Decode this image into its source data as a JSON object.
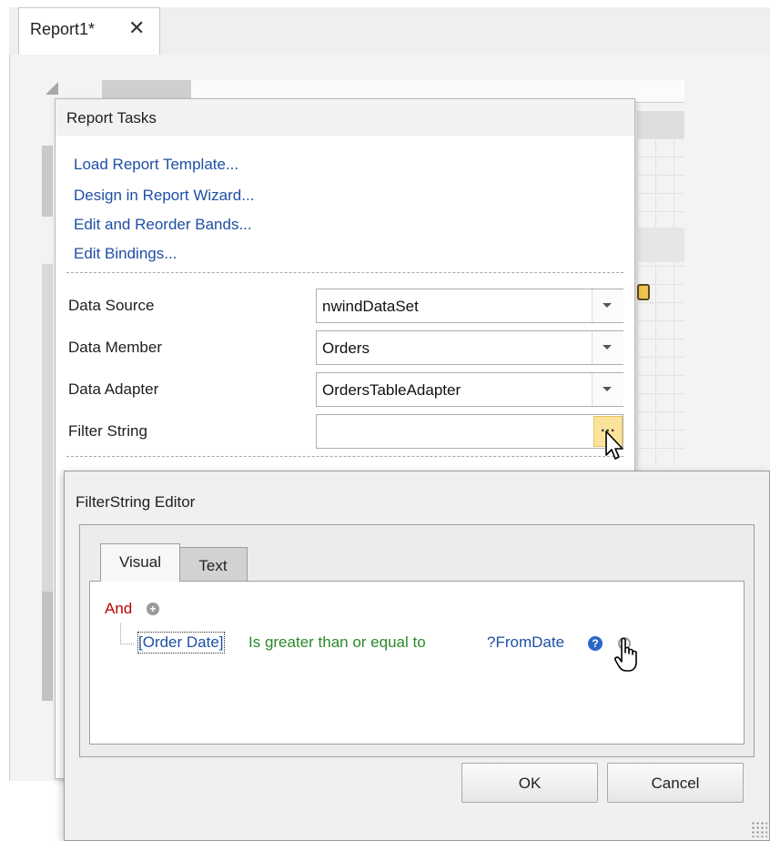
{
  "document_tab": {
    "title": "Report1*",
    "close_glyph": "✕"
  },
  "report_tasks": {
    "title": "Report Tasks",
    "links": [
      "Load Report Template...",
      "Design in Report Wizard...",
      "Edit and Reorder Bands...",
      "Edit Bindings..."
    ],
    "properties": {
      "data_source": {
        "label": "Data Source",
        "value": "nwindDataSet"
      },
      "data_member": {
        "label": "Data Member",
        "value": "Orders"
      },
      "data_adapter": {
        "label": "Data Adapter",
        "value": "OrdersTableAdapter"
      },
      "filter_string": {
        "label": "Filter String",
        "value": "",
        "button": "..."
      }
    }
  },
  "filter_editor": {
    "title": "FilterString Editor",
    "tabs": [
      {
        "label": "Visual",
        "active": true
      },
      {
        "label": "Text",
        "active": false
      }
    ],
    "group_operator": "And",
    "condition": {
      "field": "[Order Date]",
      "operator": "Is greater than or equal to",
      "value": "?FromDate"
    },
    "buttons": {
      "ok": "OK",
      "cancel": "Cancel"
    }
  },
  "colors": {
    "link": "#1f4fa5",
    "operator_and": "#c00000",
    "condition_operator": "#2a8a2a",
    "ellipsis_highlight": "#fbe39b"
  }
}
